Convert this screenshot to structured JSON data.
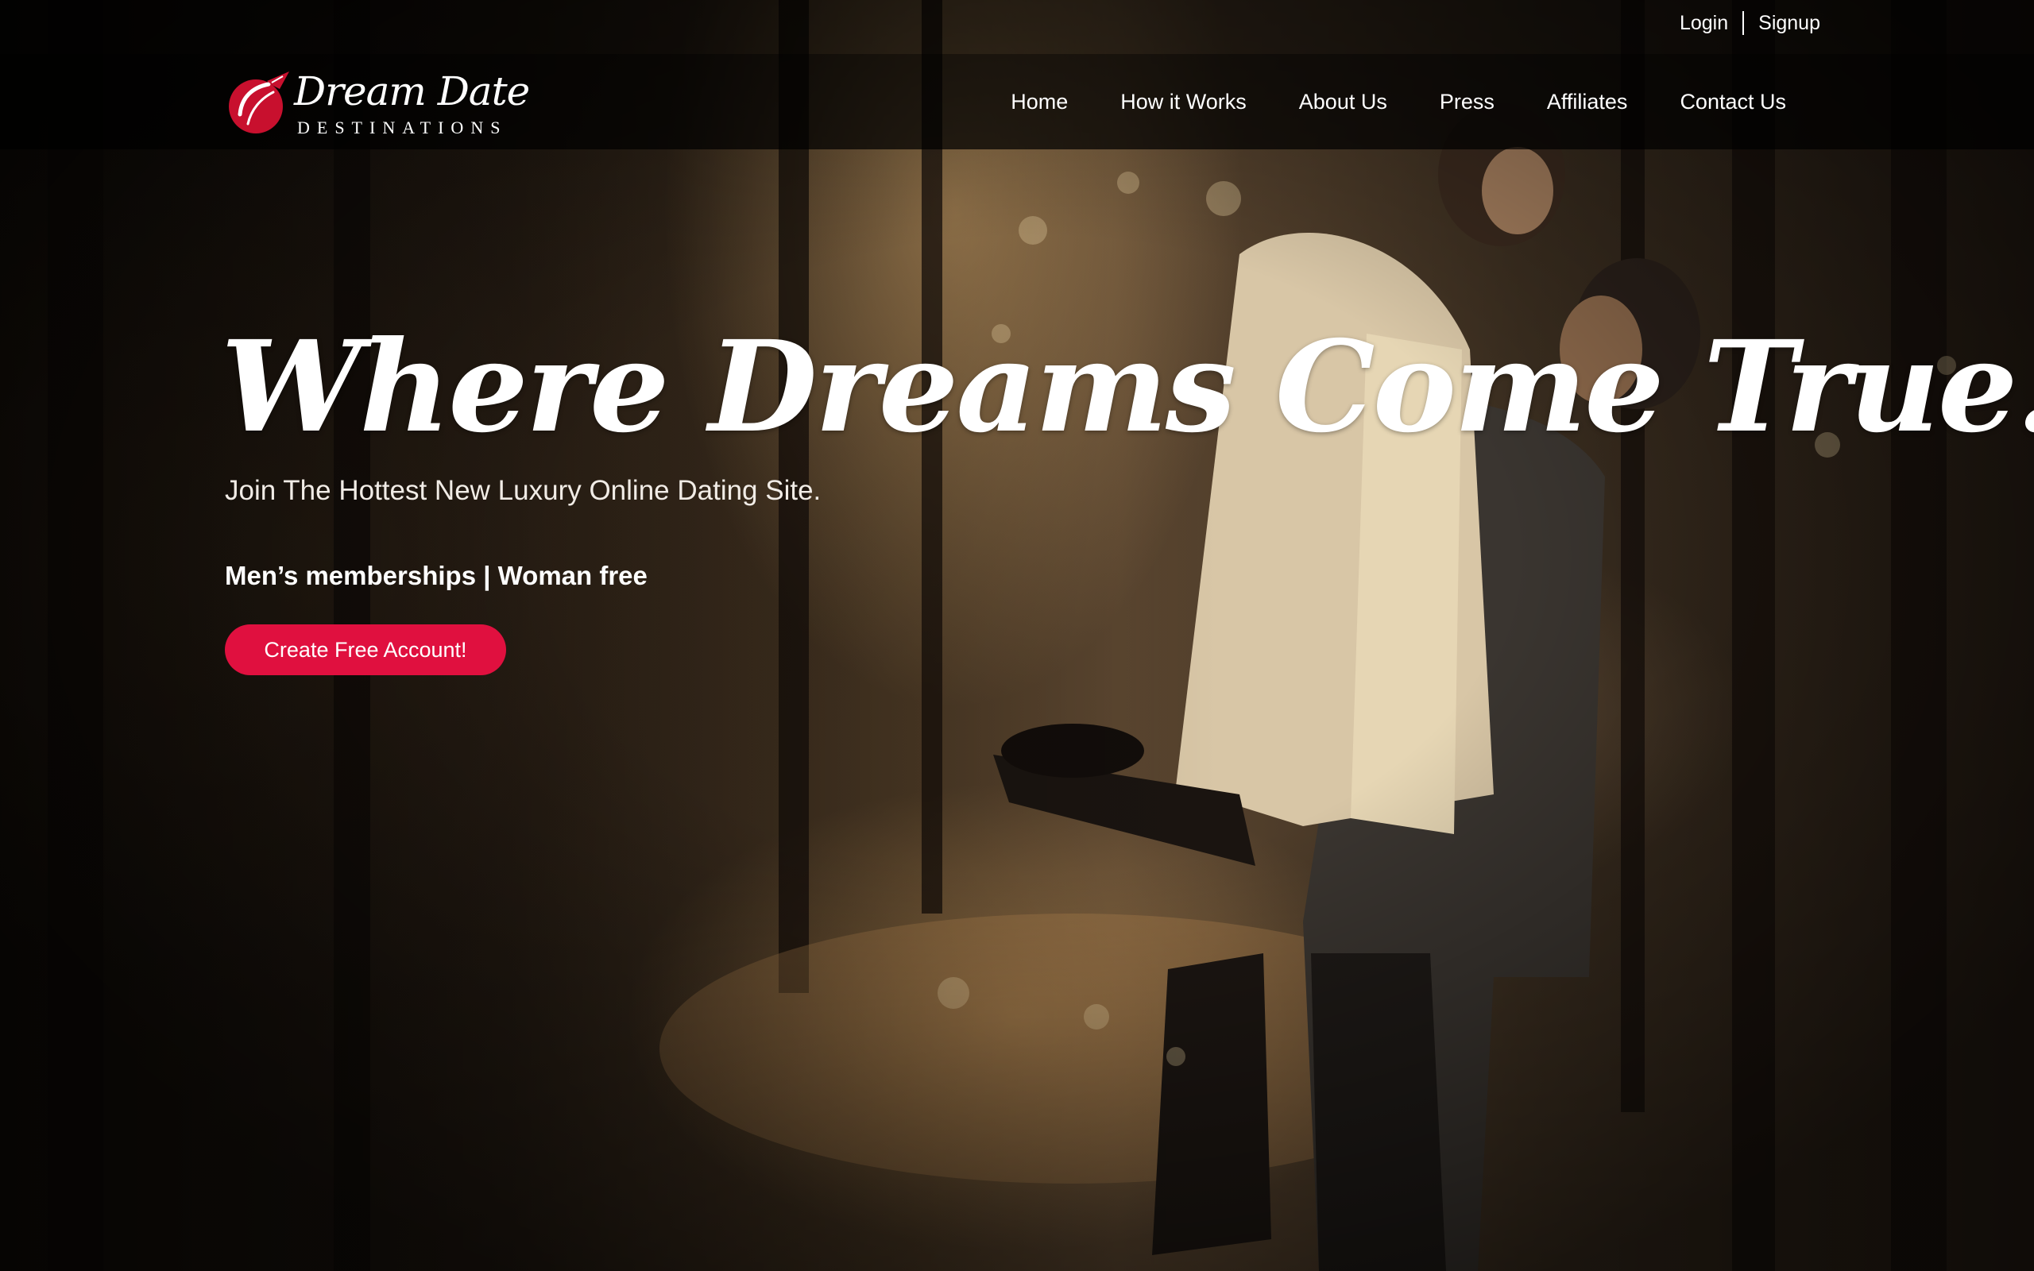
{
  "brand": {
    "name_script": "Dream Date",
    "name_sub": "DESTINATIONS",
    "accent_color": "#e0103f"
  },
  "top_links": {
    "login": "Login",
    "signup": "Signup"
  },
  "nav": {
    "items": [
      {
        "label": "Home"
      },
      {
        "label": "How it Works"
      },
      {
        "label": "About Us"
      },
      {
        "label": "Press"
      },
      {
        "label": "Affiliates"
      },
      {
        "label": "Contact Us"
      }
    ]
  },
  "hero": {
    "title": "Where Dreams Come True.",
    "subtitle": "Join The Hottest New Luxury Online Dating Site.",
    "note": "Men’s memberships | Woman free",
    "cta_label": "Create Free Account!"
  },
  "icons": {
    "logo_mark": "red-heart-airplane-icon"
  }
}
